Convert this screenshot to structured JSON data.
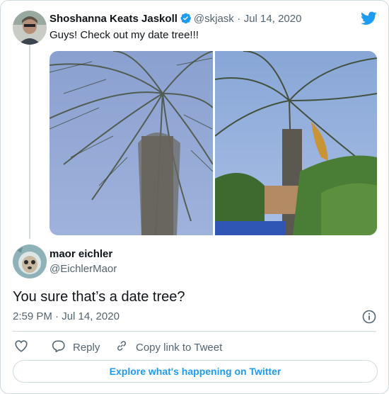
{
  "parent_tweet": {
    "author_name": "Shoshanna Keats Jaskoll",
    "handle": "@skjask",
    "separator": "·",
    "date": "Jul 14, 2020",
    "text": "Guys! Check out my date tree!!!"
  },
  "reply_tweet": {
    "author_name": "maor eichler",
    "handle": "@EichlerMaor",
    "text": "You sure that’s a date tree?",
    "timestamp": "2:59 PM · Jul 14, 2020"
  },
  "actions": {
    "reply_label": "Reply",
    "copy_link_label": "Copy link to Tweet"
  },
  "footer": {
    "explore_label": "Explore what's happening on Twitter"
  },
  "colors": {
    "twitter_blue": "#1d9bf0",
    "muted_text": "#536471",
    "border": "#cfd9de"
  },
  "icons": [
    "twitter-bird-icon",
    "verified-badge-icon",
    "info-icon",
    "heart-icon",
    "reply-bubble-icon",
    "link-icon"
  ]
}
